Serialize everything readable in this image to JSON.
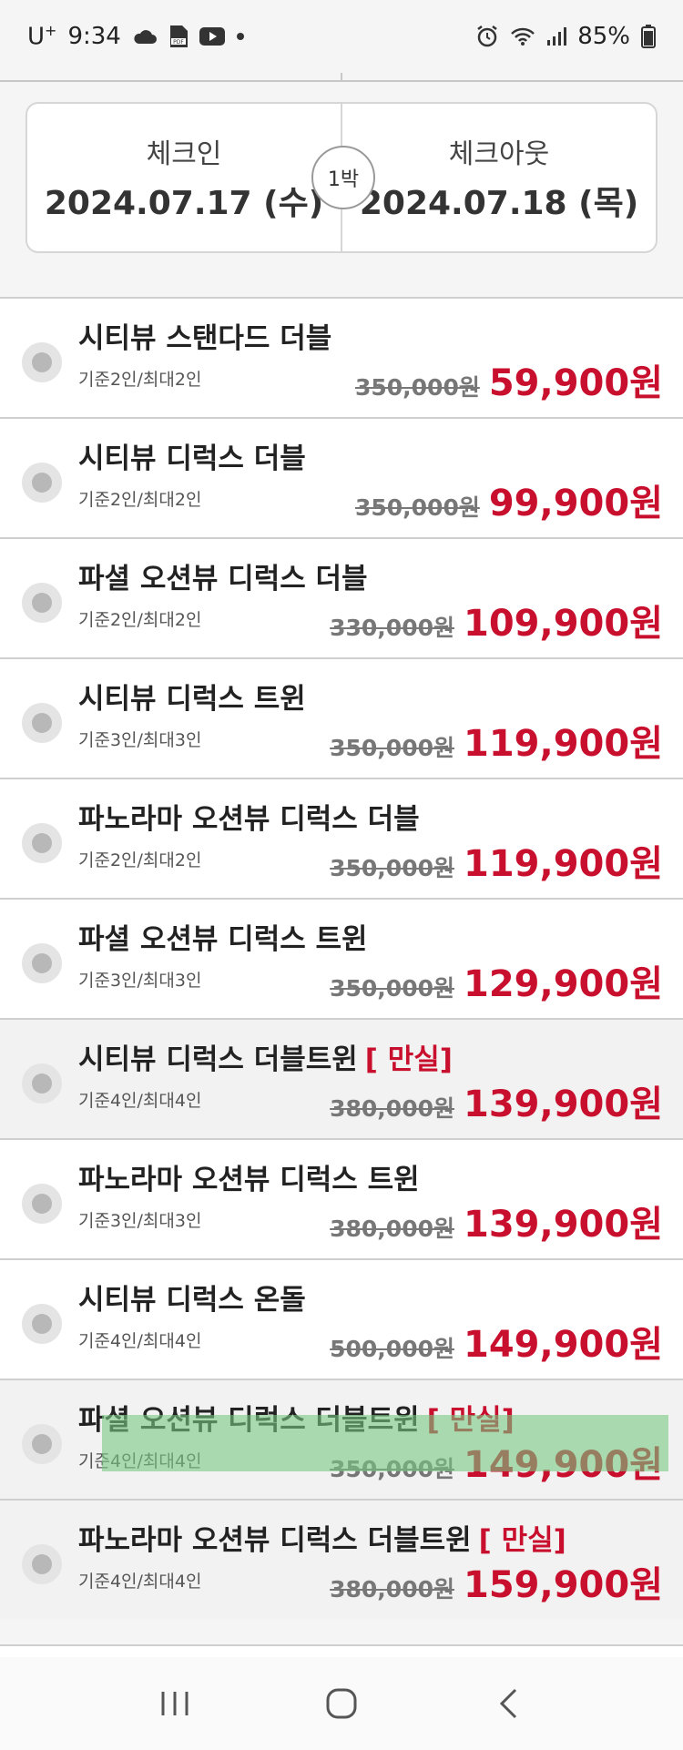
{
  "status_bar": {
    "carrier": "U",
    "carrier_sup": "+",
    "time": "9:34",
    "battery": "85%"
  },
  "date_box": {
    "checkin_label": "체크인",
    "checkin_date": "2024.07.17 (수)",
    "nights": "1박",
    "checkout_label": "체크아웃",
    "checkout_date": "2024.07.18 (목)"
  },
  "rooms": [
    {
      "name": "시티뷰 스탠다드 더블",
      "soldout": "",
      "capacity": "기준2인/최대2인",
      "orig_price": "350,000원",
      "sale_price": "59,900원"
    },
    {
      "name": "시티뷰 디럭스 더블",
      "soldout": "",
      "capacity": "기준2인/최대2인",
      "orig_price": "350,000원",
      "sale_price": "99,900원"
    },
    {
      "name": "파셜 오션뷰 디럭스 더블",
      "soldout": "",
      "capacity": "기준2인/최대2인",
      "orig_price": "330,000원",
      "sale_price": "109,900원"
    },
    {
      "name": "시티뷰 디럭스 트윈",
      "soldout": "",
      "capacity": "기준3인/최대3인",
      "orig_price": "350,000원",
      "sale_price": "119,900원"
    },
    {
      "name": "파노라마 오션뷰 디럭스 더블",
      "soldout": "",
      "capacity": "기준2인/최대2인",
      "orig_price": "350,000원",
      "sale_price": "119,900원"
    },
    {
      "name": "파셜 오션뷰 디럭스 트윈",
      "soldout": "",
      "capacity": "기준3인/최대3인",
      "orig_price": "350,000원",
      "sale_price": "129,900원"
    },
    {
      "name": "시티뷰 디럭스 더블트윈",
      "soldout": "[ 만실]",
      "capacity": "기준4인/최대4인",
      "orig_price": "380,000원",
      "sale_price": "139,900원"
    },
    {
      "name": "파노라마 오션뷰 디럭스 트윈",
      "soldout": "",
      "capacity": "기준3인/최대3인",
      "orig_price": "380,000원",
      "sale_price": "139,900원"
    },
    {
      "name": "시티뷰 디럭스 온돌",
      "soldout": "",
      "capacity": "기준4인/최대4인",
      "orig_price": "500,000원",
      "sale_price": "149,900원"
    },
    {
      "name": "파셜 오션뷰 디럭스 더블트윈",
      "soldout": "[ 만실]",
      "capacity": "기준4인/최대4인",
      "orig_price": "350,000원",
      "sale_price": "149,900원"
    },
    {
      "name": "파노라마 오션뷰 디럭스 더블트윈",
      "soldout": "[ 만실]",
      "capacity": "기준4인/최대4인",
      "orig_price": "380,000원",
      "sale_price": "159,900원"
    }
  ],
  "colors": {
    "accent_red": "#c8102e",
    "highlight_green": "#78c882"
  },
  "icons": {
    "status_left": [
      "cloud-icon",
      "pdf-icon",
      "youtube-icon",
      "dot-icon"
    ],
    "status_right": [
      "alarm-icon",
      "wifi-icon",
      "signal-icon",
      "battery-icon"
    ],
    "nav": [
      "recent-apps-icon",
      "home-icon",
      "back-icon"
    ]
  }
}
